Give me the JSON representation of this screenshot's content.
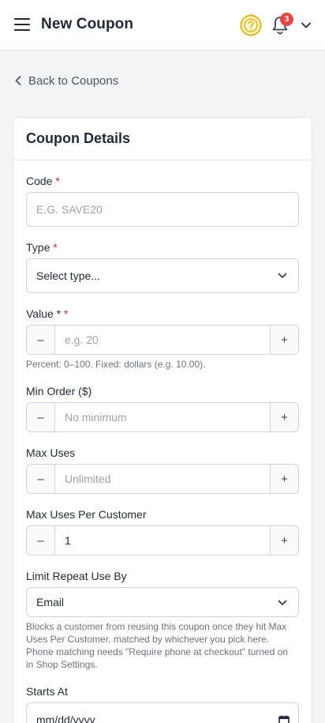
{
  "header": {
    "title": "New Coupon",
    "notification_count": "3",
    "icons": [
      "hamburger-icon",
      "help-icon",
      "bell-icon",
      "chevron-down-icon"
    ],
    "accent_color": "#eab308",
    "badge_color": "#ef4444"
  },
  "nav": {
    "back_label": "Back to Coupons"
  },
  "card": {
    "title": "Coupon Details",
    "code": {
      "label": "Code",
      "required_mark": "*",
      "placeholder": "E.G. SAVE20",
      "value": ""
    },
    "type": {
      "label": "Type",
      "required_mark": "*",
      "selected": "Select type..."
    },
    "value": {
      "label": "Value *",
      "required_mark": "*",
      "placeholder": "e.g. 20",
      "help": "Percent: 0–100. Fixed: dollars (e.g. 10.00)."
    },
    "min_order": {
      "label": "Min Order ($)",
      "placeholder": "No minimum"
    },
    "max_uses": {
      "label": "Max Uses",
      "placeholder": "Unlimited"
    },
    "max_uses_per_customer": {
      "label": "Max Uses Per Customer",
      "value": "1"
    },
    "limit_repeat": {
      "label": "Limit Repeat Use By",
      "selected": "Email",
      "help": "Blocks a customer from reusing this coupon once they hit Max Uses Per Customer, matched by whichever you pick here. Phone matching needs \"Require phone at checkout\" turned on in Shop Settings."
    },
    "starts_at": {
      "label": "Starts At",
      "value": "mm/dd/yyyy"
    },
    "stepper": {
      "minus": "–",
      "plus": "+"
    }
  }
}
